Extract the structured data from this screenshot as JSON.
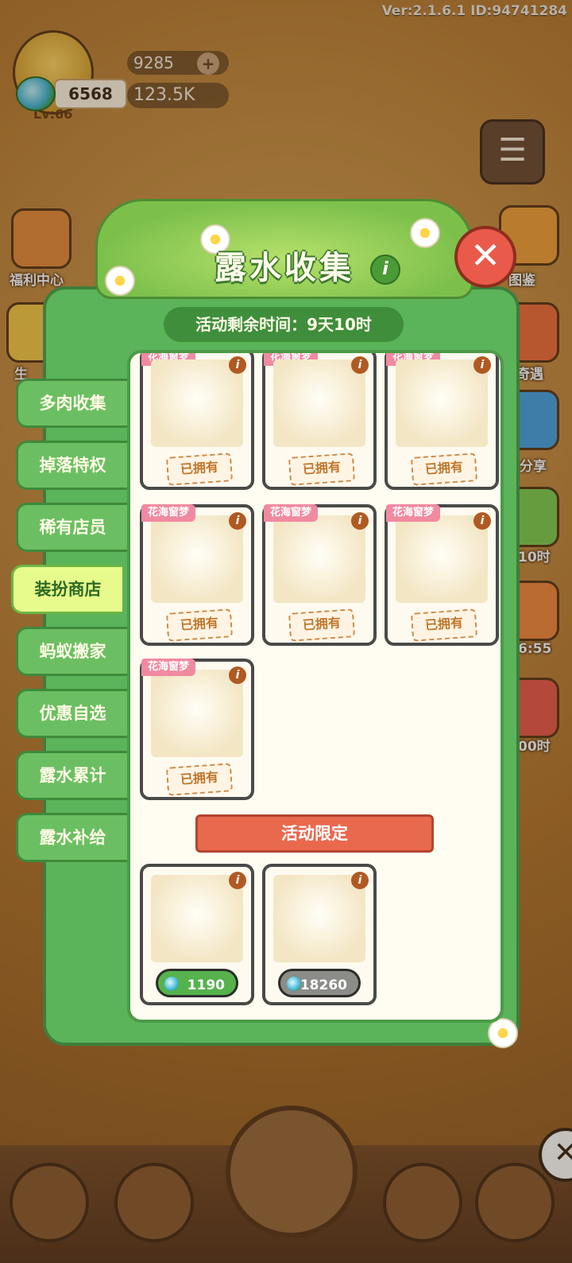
{
  "top": {
    "version": "Ver:2.1.6.1 ID:94741284",
    "level": "Lv:66",
    "gems": "9285",
    "dew": "6568",
    "coins": "123.5K"
  },
  "side_left": [
    "福利中心",
    "生"
  ],
  "side_right": [
    "图鉴",
    "奇遇",
    "分享",
    "10时",
    "6:55",
    "00时"
  ],
  "panel": {
    "title": "露水收集",
    "timer": "活动剩余时间：9天10时",
    "tabs": [
      "多肉收集",
      "掉落特权",
      "稀有店员",
      "装扮商店",
      "蚂蚁搬家",
      "优惠自选",
      "露水累计",
      "露水补给"
    ],
    "active_tab": "装扮商店",
    "owned_label": "已拥有",
    "series_tag": "花海窗梦",
    "section_limited": "活动限定",
    "limited_items": [
      {
        "price": "1190",
        "style": "green"
      },
      {
        "price": "18260",
        "style": "grey"
      }
    ]
  },
  "colors": {
    "panel_green": "#5bb35a",
    "active_tab": "#e7fb8c",
    "close_red": "#ea5a4a",
    "ribbon": "#e9694e",
    "tag_pink": "#f08aa0"
  }
}
